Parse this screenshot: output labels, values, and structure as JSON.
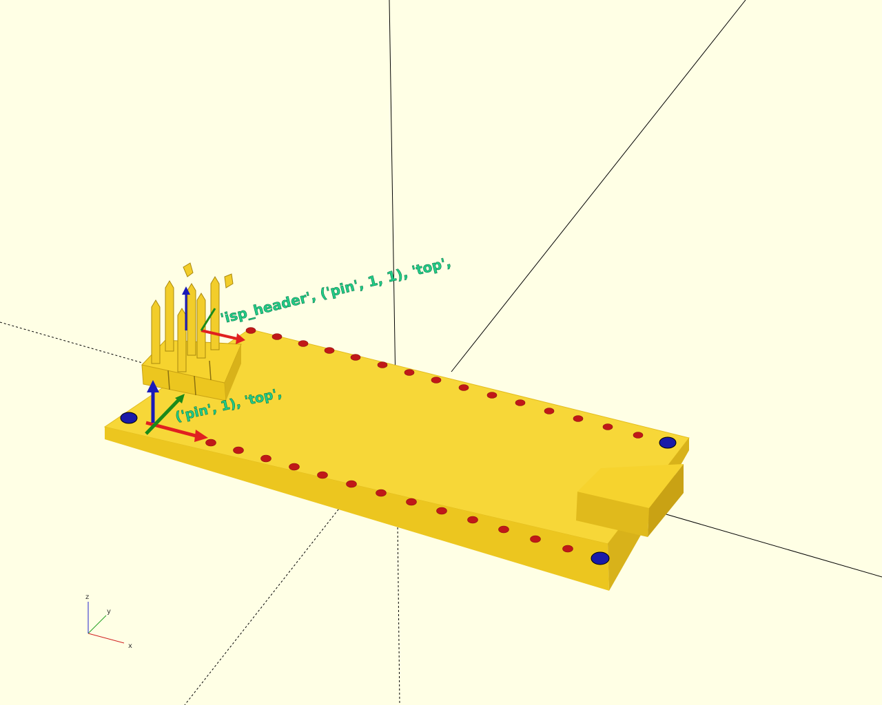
{
  "viewport": {
    "background": "#ffffe5",
    "board_color": "#f6d32e",
    "board_shade": "#d9b21f",
    "hole_color": "#c01818",
    "mount_hole_color": "#1a1aa8"
  },
  "labels": {
    "header_anchor": "'isp_header', ('pin', 1, 1), 'top',",
    "pin_anchor": "('pin', 1), 'top',"
  },
  "axis_indicator": {
    "x": "x",
    "y": "y",
    "z": "z",
    "x_color": "#d02020",
    "y_color": "#20a020",
    "z_color": "#2020d0"
  }
}
